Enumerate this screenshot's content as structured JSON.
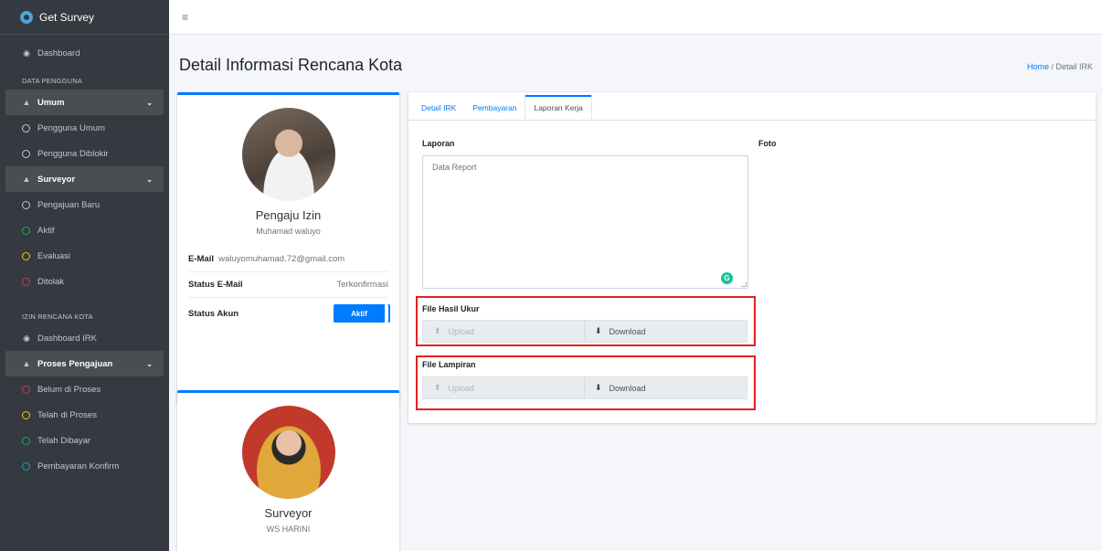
{
  "app": {
    "brand": "Get Survey"
  },
  "sidebar": {
    "dashboard": "Dashboard",
    "header_pengguna": "DATA PENGGUNA",
    "umum": "Umum",
    "pengguna_umum": "Pengguna Umum",
    "pengguna_diblokir": "Pengguna Diblokir",
    "surveyor": "Surveyor",
    "pengajuan_baru": "Pengajuan Baru",
    "aktif": "Aktif",
    "evaluasi": "Evaluasi",
    "ditolak": "Ditolak",
    "header_irk": "IZIN RENCANA KOTA",
    "dashboard_irk": "Dashboard IRK",
    "proses_pengajuan": "Proses Pengajuan",
    "belum_diproses": "Belum di Proses",
    "telah_diproses": "Telah di Proses",
    "telah_dibayar": "Telah Dibayar",
    "pembayaran_konfirm": "Pembayaran Konfirm"
  },
  "topbar": {
    "menu_icon": "hamburger-icon"
  },
  "page": {
    "title": "Detail Informasi Rencana Kota",
    "breadcrumb_home": "Home",
    "breadcrumb_sep": " / ",
    "breadcrumb_current": "Detail IRK"
  },
  "applicant": {
    "role": "Pengaju Izin",
    "name": "Muhamad waluyo",
    "email_label": "E-Mail",
    "email": "waluyomuhamad.72@gmail.com",
    "status_email_label": "Status E-Mail",
    "status_email": "Terkonfirmasi",
    "status_akun_label": "Status Akun",
    "status_akun": "Aktif"
  },
  "surveyor": {
    "role": "Surveyor",
    "name": "WS HARINI"
  },
  "tabs": [
    "Detail IRK",
    "Pembayaran",
    "Laporan Kerja"
  ],
  "laporan": {
    "label": "Laporan",
    "value": "Data Report",
    "foto_label": "Foto"
  },
  "files": {
    "hasil_ukur_label": "File Hasil Ukur",
    "lampiran_label": "File Lampiran",
    "upload": "Upload",
    "download": "Download"
  },
  "colors": {
    "accent": "#007bff",
    "sidebar": "#343a40",
    "highlight": "#e32222"
  }
}
